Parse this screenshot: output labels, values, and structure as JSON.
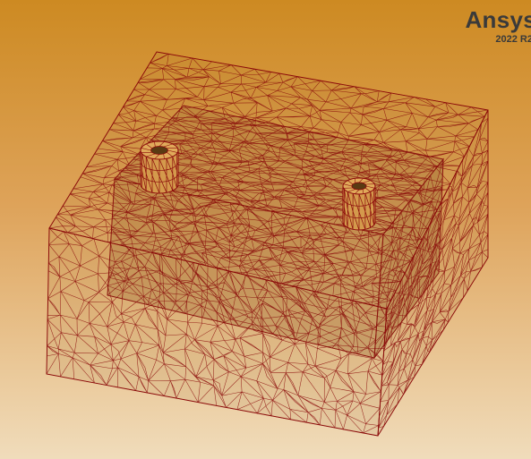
{
  "branding": {
    "product": "Ansys",
    "version": "2022 R2"
  },
  "colors": {
    "background_top": "#cd8a22",
    "background_bottom": "#f0dcbb",
    "mesh_edge": "#8b0a0a",
    "solid_face": "#a0703a",
    "brand_text": "#3a3a3a"
  },
  "viewport": {
    "view": "isometric",
    "display_style": "mesh-wireframe",
    "bodies": [
      "outer-enclosure",
      "inner-block",
      "cylinder-left",
      "cylinder-right"
    ]
  }
}
